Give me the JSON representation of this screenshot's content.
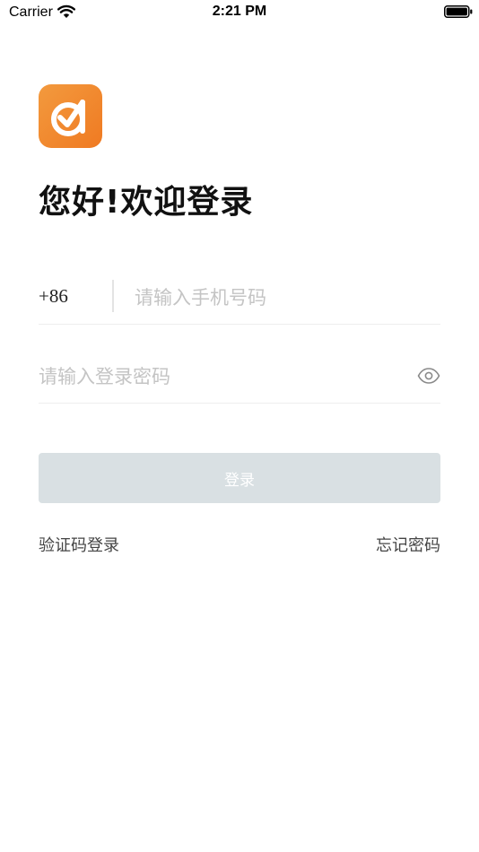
{
  "status_bar": {
    "carrier": "Carrier",
    "time": "2:21 PM",
    "wifi_icon": "wifi-icon",
    "battery_icon": "battery-icon"
  },
  "brand": {
    "logo_icon": "app-logo-check-icon",
    "accent_color": "#ef7a22"
  },
  "greeting": "您好!欢迎登录",
  "phone": {
    "country_code": "+86",
    "value": "",
    "placeholder": "请输入手机号码"
  },
  "password": {
    "value": "",
    "placeholder": "请输入登录密码",
    "toggle_icon": "eye-icon"
  },
  "login_button": {
    "label": "登录",
    "disabled_color": "#d9e0e3"
  },
  "links": {
    "sms_login": "验证码登录",
    "forgot_password": "忘记密码"
  }
}
